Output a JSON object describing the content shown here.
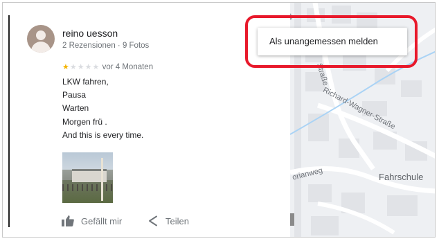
{
  "review": {
    "author_name": "reino uesson",
    "author_meta": "2 Rezensionen · 9 Fotos",
    "rating": 1,
    "rating_max": 5,
    "time_ago": "vor 4 Monaten",
    "text_lines": [
      "LKW fahren,",
      "Pausa",
      "Warten",
      "Morgen frü .",
      "And this is every time."
    ]
  },
  "actions": {
    "like_label": "Gefällt mir",
    "share_label": "Teilen"
  },
  "menu": {
    "report_label": "Als unangemessen melden"
  },
  "map": {
    "street_1": "Richard-Wagner-Straße",
    "street_2": "Straße",
    "street_3": "orianweg",
    "street_4": "ra",
    "poi": "Fahrschule"
  },
  "colors": {
    "star_on": "#f4b400",
    "star_off": "#dadce0",
    "highlight": "#e8192b",
    "map_water": "#aad3f5"
  },
  "icons": {
    "like": "thumb-up-icon",
    "share": "share-icon"
  }
}
